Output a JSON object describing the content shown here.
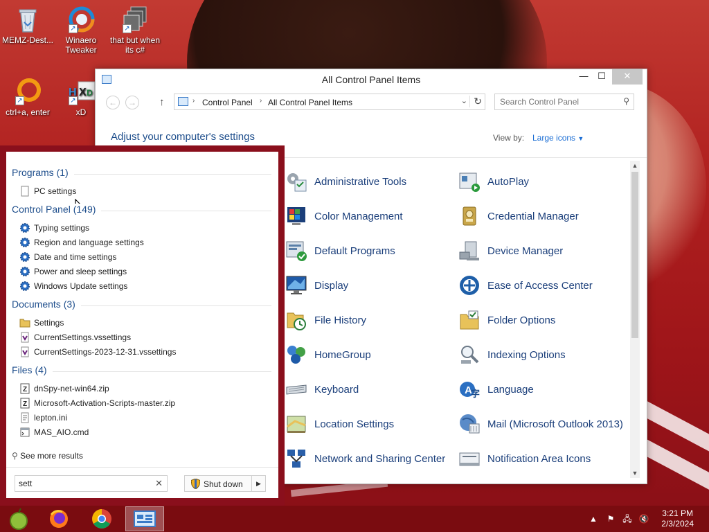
{
  "desktop": {
    "icons": [
      {
        "label": "MEMZ-Dest...",
        "icon": "recycle-bin-icon"
      },
      {
        "label": "Winaero Tweaker",
        "icon": "winaero-icon"
      },
      {
        "label": "that but when its c#",
        "icon": "stacked-windows-icon"
      },
      {
        "label": "ctrl+a, enter",
        "icon": "orange-ring-icon"
      },
      {
        "label": "xD",
        "icon": "hxd-icon"
      }
    ]
  },
  "control_panel": {
    "title": "All Control Panel Items",
    "window_buttons": {
      "minimize": "—",
      "maximize": "☐",
      "close": "✕"
    },
    "breadcrumb": [
      "Control Panel",
      "All Control Panel Items"
    ],
    "search_placeholder": "Search Control Panel",
    "heading": "Adjust your computer's settings",
    "view_by_label": "View by:",
    "view_by_value": "Large icons",
    "items": [
      {
        "label": "Administrative Tools",
        "icon": "administrative-tools-icon"
      },
      {
        "label": "AutoPlay",
        "icon": "autoplay-icon"
      },
      {
        "label": "Color Management",
        "icon": "color-management-icon"
      },
      {
        "label": "Credential Manager",
        "icon": "credential-manager-icon"
      },
      {
        "label": "Default Programs",
        "icon": "default-programs-icon"
      },
      {
        "label": "Device Manager",
        "icon": "device-manager-icon"
      },
      {
        "label": "Display",
        "icon": "display-icon"
      },
      {
        "label": "Ease of Access Center",
        "icon": "ease-of-access-icon"
      },
      {
        "label": "File History",
        "icon": "file-history-icon"
      },
      {
        "label": "Folder Options",
        "icon": "folder-options-icon"
      },
      {
        "label": "HomeGroup",
        "icon": "homegroup-icon"
      },
      {
        "label": "Indexing Options",
        "icon": "indexing-options-icon"
      },
      {
        "label": "Keyboard",
        "icon": "keyboard-icon"
      },
      {
        "label": "Language",
        "icon": "language-icon"
      },
      {
        "label": "Location Settings",
        "icon": "location-settings-icon"
      },
      {
        "label": "Mail (Microsoft Outlook 2013)",
        "icon": "mail-icon"
      },
      {
        "label": "Network and Sharing Center",
        "icon": "network-sharing-icon"
      },
      {
        "label": "Notification Area Icons",
        "icon": "notification-area-icon"
      }
    ]
  },
  "start_search": {
    "groups": [
      {
        "title": "Programs (1)",
        "results": [
          {
            "label": "PC settings",
            "icon": "blank-page-icon"
          }
        ]
      },
      {
        "title": "Control Panel (149)",
        "results": [
          {
            "label": "Typing settings",
            "icon": "gear-icon"
          },
          {
            "label": "Region and language settings",
            "icon": "gear-icon"
          },
          {
            "label": "Date and time settings",
            "icon": "gear-icon"
          },
          {
            "label": "Power and sleep settings",
            "icon": "gear-icon"
          },
          {
            "label": "Windows Update settings",
            "icon": "gear-icon"
          }
        ]
      },
      {
        "title": "Documents (3)",
        "results": [
          {
            "label": "Settings",
            "icon": "folder-icon"
          },
          {
            "label": "CurrentSettings.vssettings",
            "icon": "vs-file-icon"
          },
          {
            "label": "CurrentSettings-2023-12-31.vssettings",
            "icon": "vs-file-icon"
          }
        ]
      },
      {
        "title": "Files (4)",
        "results": [
          {
            "label": "dnSpy-net-win64.zip",
            "icon": "zip-file-icon"
          },
          {
            "label": "Microsoft-Activation-Scripts-master.zip",
            "icon": "zip-file-icon"
          },
          {
            "label": "lepton.ini",
            "icon": "ini-file-icon"
          },
          {
            "label": "MAS_AIO.cmd",
            "icon": "cmd-file-icon"
          }
        ]
      }
    ],
    "see_more": "See more results",
    "query": "sett",
    "clear_glyph": "✕",
    "shutdown_label": "Shut down"
  },
  "taskbar": {
    "apps": [
      {
        "name": "fruit-app-icon"
      },
      {
        "name": "firefox-icon"
      },
      {
        "name": "chrome-icon"
      },
      {
        "name": "control-panel-icon",
        "active": true
      }
    ],
    "tray": [
      "show-hidden-icons",
      "action-center-flag-icon",
      "network-icon",
      "volume-muted-icon"
    ],
    "time": "3:21 PM",
    "date": "2/3/2024"
  },
  "colors": {
    "start_border": "#8a0f1c",
    "taskbar": "#7a0c10",
    "link_blue": "#1a6dd4",
    "heading_blue": "#1e4e8c"
  }
}
